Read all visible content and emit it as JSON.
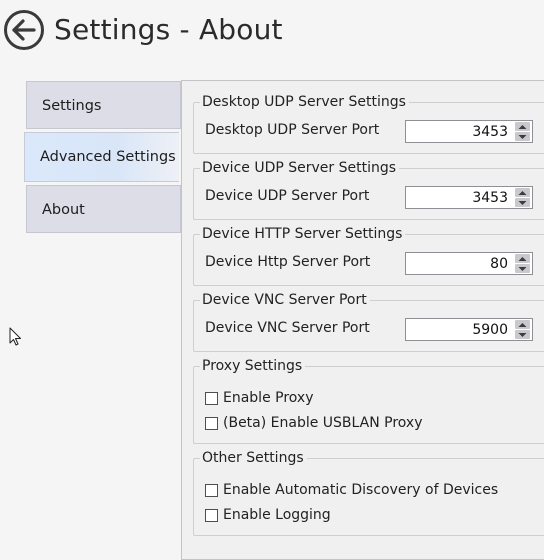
{
  "header": {
    "title": "Settings - About"
  },
  "tabs": [
    {
      "label": "Settings",
      "active": false
    },
    {
      "label": "Advanced Settings",
      "active": true
    },
    {
      "label": "About",
      "active": false
    }
  ],
  "groups": {
    "desktop_udp": {
      "title": "Desktop UDP Server Settings",
      "port_label": "Desktop UDP Server Port",
      "port_value": "3453"
    },
    "device_udp": {
      "title": "Device UDP Server Settings",
      "port_label": "Device UDP Server Port",
      "port_value": "3453"
    },
    "device_http": {
      "title": "Device HTTP Server Settings",
      "port_label": "Device Http Server Port",
      "port_value": "80"
    },
    "device_vnc": {
      "title": "Device VNC Server Port",
      "port_label": "Device VNC Server Port",
      "port_value": "5900"
    },
    "proxy": {
      "title": "Proxy Settings",
      "options": [
        {
          "label": "Enable Proxy",
          "checked": false
        },
        {
          "label": "(Beta) Enable USBLAN Proxy",
          "checked": false
        }
      ]
    },
    "other": {
      "title": "Other Settings",
      "options": [
        {
          "label": "Enable Automatic Discovery of Devices",
          "checked": false
        },
        {
          "label": "Enable Logging",
          "checked": false
        }
      ]
    }
  },
  "icons": {
    "back": "arrow-left-circle-icon",
    "spin_up": "chevron-up-icon",
    "spin_down": "chevron-down-icon",
    "cursor": "mouse-pointer-icon"
  },
  "colors": {
    "active_tab": "#dbe8fb",
    "tab": "#dcdde6",
    "panel": "#f0f0f0"
  }
}
